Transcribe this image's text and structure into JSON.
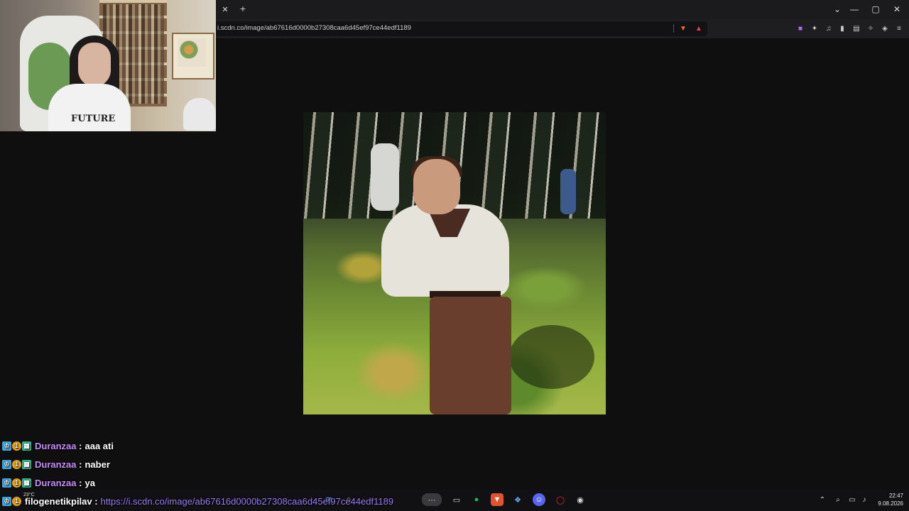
{
  "browser": {
    "url": "i.scdn.co/image/ab67616d0000b27308caa6d45ef97ce44edf1189",
    "tab_close": "✕",
    "tab_new": "+",
    "window_buttons": {
      "dropdown": "⌄",
      "minimize": "—",
      "maximize": "▢",
      "close": "✕"
    },
    "extensions": [
      "brave-shield-icon",
      "brave-rewards-icon",
      "puzzle-icon",
      "music-icon",
      "sidebar-icon",
      "wallet-icon",
      "leo-icon",
      "vpn-icon",
      "menu-icon"
    ]
  },
  "webcam": {
    "shirt_text": "FUTURE"
  },
  "chat": [
    {
      "user": "Duranzaa",
      "message": "aaa ati"
    },
    {
      "user": "Duranzaa",
      "message": "naber"
    },
    {
      "user": "Duranzaa",
      "message": "ya"
    },
    {
      "user": "filogenetikpilav",
      "message": "https://i.scdn.co/image/ab67616d0000b27308caa6d45ef97ce44edf1189"
    }
  ],
  "taskbar": {
    "weather_temp": "23°C",
    "time": "22:47",
    "date": "9.08.2026"
  },
  "colors": {
    "username": "#c58af9",
    "link": "#9c7cf4",
    "background": "#0f0f0f"
  }
}
